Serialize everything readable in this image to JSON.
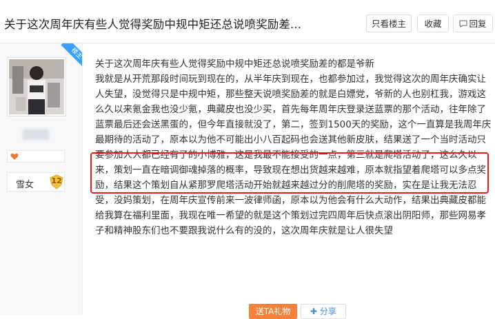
{
  "header": {
    "title": "关于这次周年庆有些人觉得奖励中规中矩还总说喷奖励差...",
    "buttons": {
      "only_louzhu": "只看楼主",
      "collect": "收藏",
      "reply": "回复"
    }
  },
  "author": {
    "badge": "楼主",
    "level_title": "雪女",
    "level": "12"
  },
  "post": {
    "text": "关于这次周年庆有些人觉得奖励中规中矩还总说喷奖励差的都是爷新\n我就是从开荒那段时间玩到现在的，从半年庆到现在，也都参加过，我觉得这次的周年庆确实让人失望，没觉得只是中规中矩，那些整天说喷奖励差的就是白嫖党，爷新的人也别杠我，游戏这么久以来氪金我也没少氪，典藏皮也没少买，首先每年周年庆登录送蓝票的那个活动，往年除了蓝票最后还会送黑蛋的，但今年直接就没了，第二，签到1500天的奖励，这个一直算是我周年庆最期待的活动了，原本以为他不可能出小八百起码也会送其他新皮肤，结果送了一个当时活动只要参加人人都已经有了的小博雅，这是我最不能接受的一点，第三就是爬塔活动了，这么久以来，策划一直在暗调御魂掉落的概率，导致现在想出货越来越难，原本就指望着爬塔可以多点奖励，结果这个策划自从紧那罗爬塔活动开始就越来越过分的削爬塔的奖励，实在是让我无法忍受，没妈策划，在周年庆宣传前来一波律师函，原本以为他会有什么大动作，结果出典藏皮都能给我算在福利里面，我现在唯一希望的就是这个策划过完四周年后快点滚出阴阳师，那些网易孝子和精神股东们也不要跟我说什么有的没的，这次周年庆就是让人很失望"
  },
  "actions": {
    "gift": "送TA礼物",
    "share": "分享"
  },
  "colors": {
    "accent_blue": "#3aa0ff",
    "highlight_red": "#e61e1e",
    "gift_orange": "#f7813a"
  }
}
